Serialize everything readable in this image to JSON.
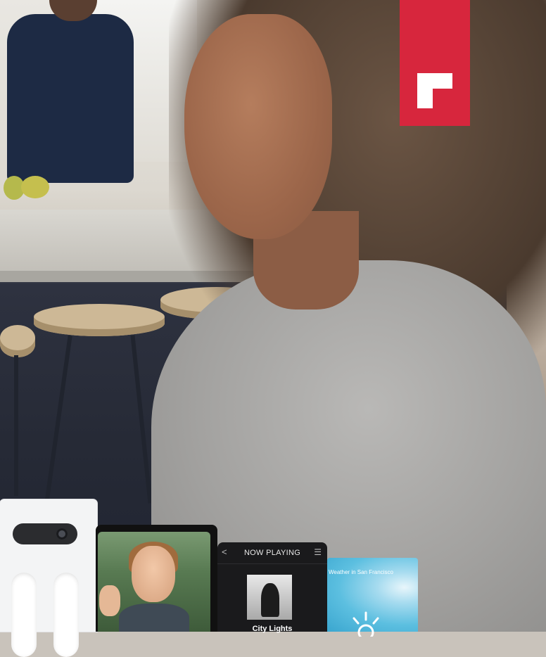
{
  "brand": {
    "accent_color": "#d7263d",
    "logo_icon": "brand-logo-icon"
  },
  "devices": {
    "camera": {
      "icon": "camera-lens-icon"
    },
    "video_call": {
      "icon": "video-person-icon"
    },
    "music_player": {
      "header": "NOW PLAYING",
      "back_icon": "chevron-left-icon",
      "back_glyph": "<",
      "queue_icon": "list-icon",
      "queue_glyph": "☰",
      "track": "City Lights"
    },
    "weather": {
      "label": "Weather in San Francisco",
      "icon": "sun-icon"
    }
  }
}
